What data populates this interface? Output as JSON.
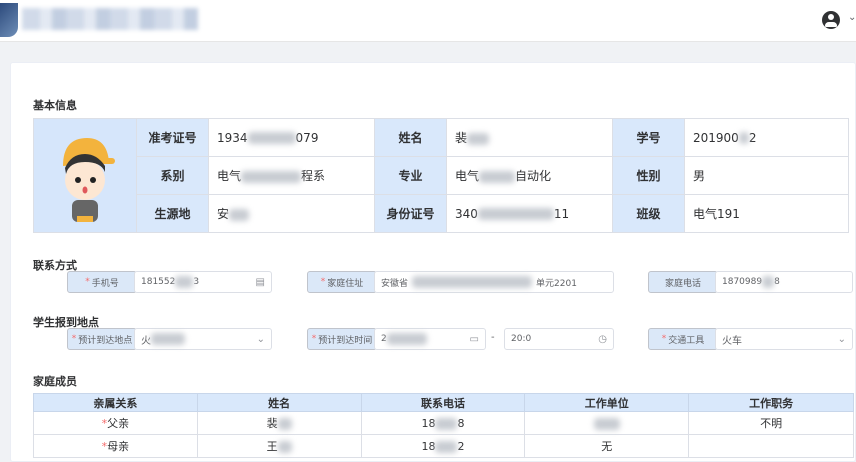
{
  "header": {
    "user_icon": "user-circle-icon"
  },
  "sections": {
    "basic": "基本信息",
    "contact": "联系方式",
    "report": "学生报到地点",
    "family": "家庭成员"
  },
  "basic": {
    "exam_no_label": "准考证号",
    "exam_no": "1934",
    "exam_no_tail": "079",
    "name_label": "姓名",
    "name": "裴",
    "student_no_label": "学号",
    "student_no": "201900",
    "student_no_tail": "2",
    "dept_label": "系别",
    "dept": "电气",
    "dept_tail": "程系",
    "major_label": "专业",
    "major": "电气",
    "major_tail": "自动化",
    "gender_label": "性别",
    "gender": "男",
    "origin_label": "生源地",
    "origin": "安",
    "id_label": "身份证号",
    "id": "340",
    "id_tail": "11",
    "class_label": "班级",
    "class": "电气191"
  },
  "contact": {
    "phone_label": "手机号",
    "phone": "181552",
    "phone_tail": "3",
    "address_label": "家庭住址",
    "address": "安徽省",
    "address_tail": "单元2201",
    "home_phone_label": "家庭电话",
    "home_phone": "1870989",
    "home_phone_tail": "8"
  },
  "report": {
    "place_label": "预计到达地点",
    "place": "火",
    "time_label": "预计到达时间",
    "time": "2",
    "separator": "-",
    "time_end": "20:0",
    "transport_label": "交通工具",
    "transport": "火车"
  },
  "family": {
    "headers": [
      "亲属关系",
      "姓名",
      "联系电话",
      "工作单位",
      "工作职务"
    ],
    "rows": [
      {
        "relation": "父亲",
        "name": "裴",
        "phone": "18",
        "phone_tail": "8",
        "unit": "",
        "job": "不明"
      },
      {
        "relation": "母亲",
        "name": "王",
        "phone": "18",
        "phone_tail": "2",
        "unit": "无",
        "job": ""
      }
    ]
  }
}
